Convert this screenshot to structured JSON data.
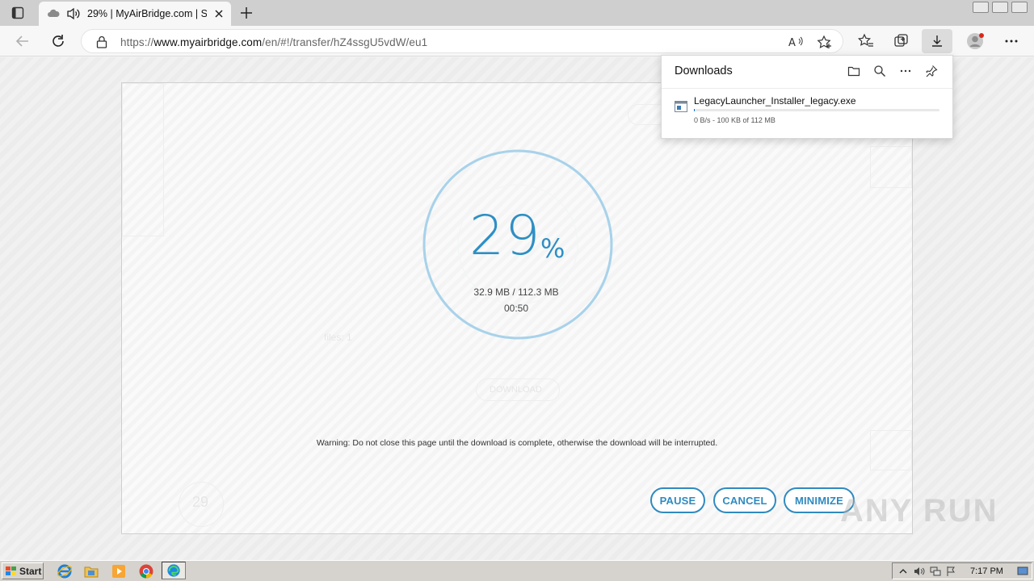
{
  "browser": {
    "tab": {
      "title": "29% | MyAirBridge.com | S"
    },
    "address": {
      "scheme": "https://",
      "host": "www.myairbridge.com",
      "path": "/en/#!/transfer/hZ4ssgU5vdW/eu1"
    }
  },
  "downloads_panel": {
    "title": "Downloads",
    "items": [
      {
        "filename": "LegacyLauncher_Installer_legacy.exe",
        "status": "0 B/s - 100 KB of 112 MB",
        "progress": 0.001
      }
    ]
  },
  "transfer": {
    "percent": "29",
    "percent_symbol": "%",
    "progress": 0.29,
    "sizes": "32.9 MB / 112.3 MB",
    "time_left": "00:50",
    "warning": "Warning: Do not close this page until the download is complete, otherwise the download will be interrupted.",
    "buttons": {
      "pause": "PAUSE",
      "cancel": "CANCEL",
      "minimize": "MINIMIZE"
    }
  },
  "background_ghost": {
    "files_label": "files: 1",
    "download_label": "DOWNLOAD",
    "mini_percent": "29"
  },
  "watermark": "ANY RUN",
  "taskbar": {
    "start_label": "Start",
    "clock": "7:17 PM"
  },
  "colors": {
    "accent": "#2e8fc5",
    "ring": "#a8d2ea"
  }
}
